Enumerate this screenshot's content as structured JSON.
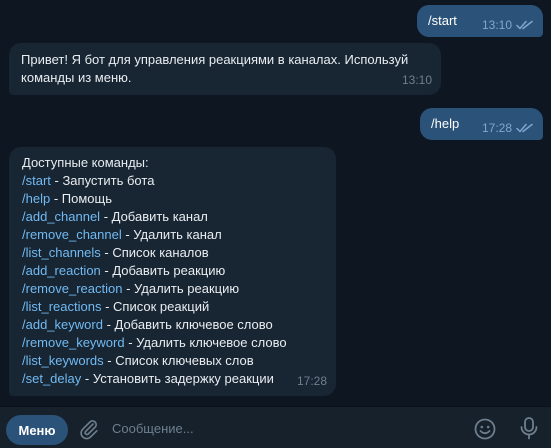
{
  "messages": [
    {
      "from": "me",
      "text": "/start",
      "time": "13:10",
      "read": true
    },
    {
      "from": "bot",
      "text": "Привет! Я бот для управления реакциями в каналах. Используй",
      "text2": "команды из меню.",
      "time": "13:10"
    },
    {
      "from": "me",
      "text": "/help",
      "time": "17:28",
      "read": true
    },
    {
      "from": "bot",
      "header": "Доступные команды:",
      "commands": [
        {
          "cmd": "/start",
          "desc": " - Запустить бота"
        },
        {
          "cmd": "/help",
          "desc": " - Помощь"
        },
        {
          "cmd": "/add_channel",
          "desc": " - Добавить канал"
        },
        {
          "cmd": "/remove_channel",
          "desc": " - Удалить канал"
        },
        {
          "cmd": "/list_channels",
          "desc": " - Список каналов"
        },
        {
          "cmd": "/add_reaction",
          "desc": " - Добавить реакцию"
        },
        {
          "cmd": "/remove_reaction",
          "desc": " - Удалить реакцию"
        },
        {
          "cmd": "/list_reactions",
          "desc": " - Список реакций"
        },
        {
          "cmd": "/add_keyword",
          "desc": " - Добавить ключевое слово"
        },
        {
          "cmd": "/remove_keyword",
          "desc": " - Удалить ключевое слово"
        },
        {
          "cmd": "/list_keywords",
          "desc": " - Список ключевых слов"
        },
        {
          "cmd": "/set_delay",
          "desc": " - Установить задержку реакции"
        }
      ],
      "time": "17:28"
    }
  ],
  "input_bar": {
    "menu_label": "Меню",
    "placeholder": "Сообщение...",
    "icons": [
      "paperclip-icon",
      "emoji-icon",
      "microphone-icon"
    ]
  },
  "colors": {
    "background": "#0e1621",
    "outgoing_bubble": "#2b5278",
    "incoming_bubble": "#182533",
    "link": "#71baf2",
    "input_bar": "#17212b"
  }
}
